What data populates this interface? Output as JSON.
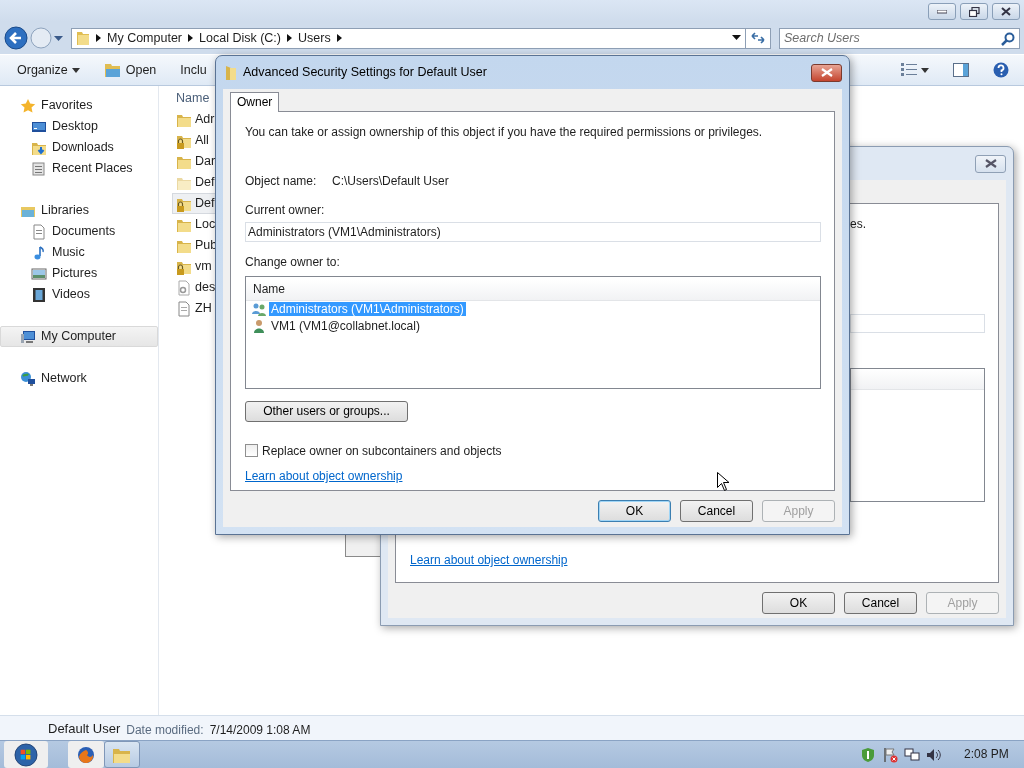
{
  "explorer": {
    "breadcrumb": [
      {
        "label": "My Computer"
      },
      {
        "label": "Local Disk (C:)"
      },
      {
        "label": "Users"
      }
    ],
    "search": {
      "placeholder": "Search Users"
    },
    "toolbar": [
      {
        "label": "Organize",
        "kind": "menu"
      },
      {
        "label": "Open",
        "kind": "open"
      },
      {
        "label": "Inclu",
        "kind": "plain"
      }
    ],
    "sidebar": [
      {
        "label": "Favorites",
        "kind": "star",
        "selected": false,
        "children": [
          {
            "label": "Desktop",
            "kind": "desktop",
            "selected": false
          },
          {
            "label": "Downloads",
            "kind": "downloads",
            "selected": false
          },
          {
            "label": "Recent Places",
            "kind": "recent",
            "selected": false
          }
        ]
      },
      {
        "label": "Libraries",
        "kind": "libraries",
        "selected": false,
        "children": [
          {
            "label": "Documents",
            "kind": "documents",
            "selected": false
          },
          {
            "label": "Music",
            "kind": "music",
            "selected": false
          },
          {
            "label": "Pictures",
            "kind": "pictures",
            "selected": false
          },
          {
            "label": "Videos",
            "kind": "videos",
            "selected": false
          }
        ]
      },
      {
        "label": "My Computer",
        "kind": "computer",
        "selected": true
      },
      {
        "label": "Network",
        "kind": "network",
        "selected": false
      }
    ],
    "files": {
      "column": "Name",
      "rows": [
        {
          "name": "Adr",
          "kind": "folder",
          "selected": false
        },
        {
          "name": "All",
          "kind": "locked",
          "selected": false
        },
        {
          "name": "Dar",
          "kind": "folder",
          "selected": false
        },
        {
          "name": "Def",
          "kind": "hidden",
          "selected": false
        },
        {
          "name": "Def",
          "kind": "locked",
          "selected": true
        },
        {
          "name": "Loc",
          "kind": "folder",
          "selected": false
        },
        {
          "name": "Pub",
          "kind": "folder",
          "selected": false
        },
        {
          "name": "vm",
          "kind": "locked",
          "selected": false
        },
        {
          "name": "des",
          "kind": "settings",
          "selected": false
        },
        {
          "name": "ZH",
          "kind": "file",
          "selected": false
        }
      ]
    },
    "details": {
      "name": "Default User",
      "label": "Date modified:",
      "value": "7/14/2009 1:08 AM"
    }
  },
  "back_dialog": {
    "fragment": "es.",
    "link": "Learn about object ownership",
    "buttons": [
      {
        "label": "OK",
        "default": false,
        "disabled": false
      },
      {
        "label": "Cancel",
        "default": false,
        "disabled": false
      },
      {
        "label": "Apply",
        "default": false,
        "disabled": true
      }
    ]
  },
  "dialog": {
    "title": "Advanced Security Settings for Default User",
    "tabs": [
      {
        "label": "Owner",
        "selected": true
      }
    ],
    "intro": "You can take or assign ownership of this object if you have the required permissions or privileges.",
    "object_name": {
      "label": "Object name:",
      "value": "C:\\Users\\Default User"
    },
    "current_owner": {
      "label": "Current owner:",
      "value": "Administrators (VM1\\Administrators)"
    },
    "change_owner": {
      "label": "Change owner to:",
      "column": "Name",
      "rows": [
        {
          "name": "Administrators (VM1\\Administrators)",
          "kind": "group",
          "selected": true
        },
        {
          "name": "VM1 (VM1@collabnet.local)",
          "kind": "user",
          "selected": false
        }
      ]
    },
    "other_button": "Other users or groups...",
    "replace": {
      "label": "Replace owner on subcontainers and objects",
      "checked": false
    },
    "link": "Learn about object ownership",
    "buttons": [
      {
        "label": "OK",
        "default": true,
        "disabled": false
      },
      {
        "label": "Cancel",
        "default": false,
        "disabled": false
      },
      {
        "label": "Apply",
        "default": false,
        "disabled": true
      }
    ]
  },
  "taskbar": {
    "clock": "2:08 PM"
  }
}
